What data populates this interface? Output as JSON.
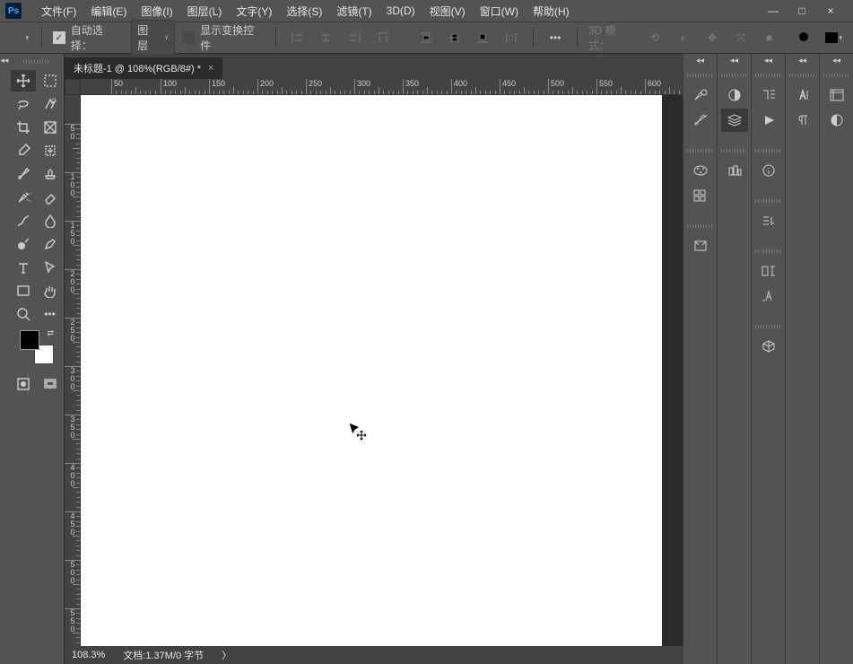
{
  "app_logo": "Ps",
  "menu": [
    "文件(F)",
    "编辑(E)",
    "图像(I)",
    "图层(L)",
    "文字(Y)",
    "选择(S)",
    "滤镜(T)",
    "3D(D)",
    "视图(V)",
    "窗口(W)",
    "帮助(H)"
  ],
  "window_controls": {
    "minimize": "—",
    "maximize": "□",
    "close": "×"
  },
  "optbar": {
    "auto_select_label": "自动选择：",
    "layer_label": "图层",
    "show_transform": "显示变换控件",
    "threed_mode": "3D 模式："
  },
  "document": {
    "tab_title": "未标题-1 @ 108%(RGB/8#) *",
    "zoom": "108.3%",
    "doc_info": "文档:1.37M/0 字节"
  },
  "ruler_h_ticks": [
    {
      "pos": 34,
      "label": "50"
    },
    {
      "pos": 89,
      "label": "100"
    },
    {
      "pos": 143,
      "label": "150"
    },
    {
      "pos": 197,
      "label": "200"
    },
    {
      "pos": 251,
      "label": "250"
    },
    {
      "pos": 305,
      "label": "300"
    },
    {
      "pos": 359,
      "label": "350"
    },
    {
      "pos": 413,
      "label": "400"
    },
    {
      "pos": 467,
      "label": "450"
    },
    {
      "pos": 521,
      "label": "500"
    },
    {
      "pos": 575,
      "label": "550"
    },
    {
      "pos": 629,
      "label": "600"
    }
  ],
  "ruler_v_ticks": [
    {
      "pos": 32,
      "label": "5\n0"
    },
    {
      "pos": 86,
      "label": "1\n0\n0"
    },
    {
      "pos": 140,
      "label": "1\n5\n0"
    },
    {
      "pos": 194,
      "label": "2\n0\n0"
    },
    {
      "pos": 248,
      "label": "2\n5\n0"
    },
    {
      "pos": 302,
      "label": "3\n0\n0"
    },
    {
      "pos": 356,
      "label": "3\n5\n0"
    },
    {
      "pos": 410,
      "label": "4\n0\n0"
    },
    {
      "pos": 464,
      "label": "4\n5\n0"
    },
    {
      "pos": 518,
      "label": "5\n0\n0"
    },
    {
      "pos": 572,
      "label": "5\n5\n0"
    }
  ]
}
